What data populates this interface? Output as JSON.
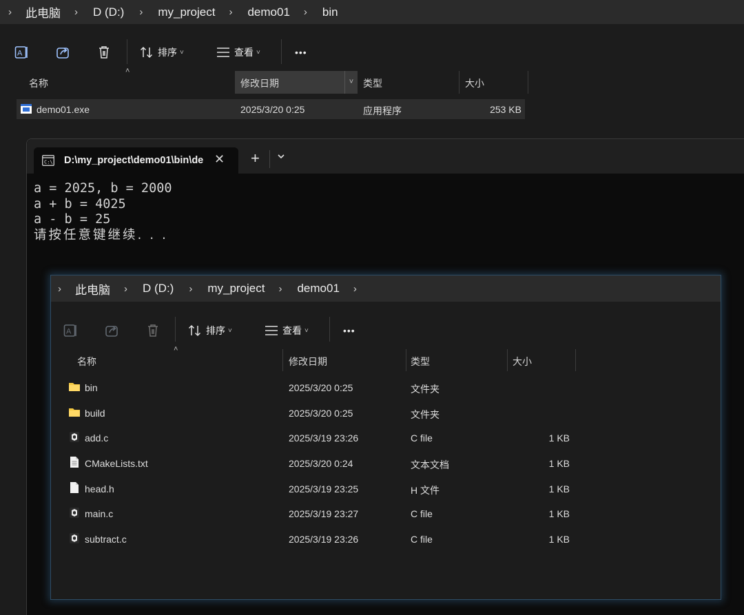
{
  "explorer_back": {
    "breadcrumb": [
      "此电脑",
      "D (D:)",
      "my_project",
      "demo01",
      "bin"
    ],
    "toolbar": {
      "sort_label": "排序",
      "view_label": "查看",
      "more_label": "•••"
    },
    "columns": {
      "name": "名称",
      "date": "修改日期",
      "type": "类型",
      "size": "大小"
    },
    "files": [
      {
        "name": "demo01.exe",
        "date": "2025/3/20 0:25",
        "type": "应用程序",
        "size": "253 KB",
        "icon": "exe-icon"
      }
    ]
  },
  "terminal": {
    "tab_title": "D:\\my_project\\demo01\\bin\\de",
    "new_tab_label": "+",
    "lines": [
      "a = 2025, b = 2000",
      "a + b = 4025",
      "a - b = 25",
      "请按任意键继续. . ."
    ]
  },
  "explorer_front": {
    "breadcrumb": [
      "此电脑",
      "D (D:)",
      "my_project",
      "demo01"
    ],
    "toolbar": {
      "sort_label": "排序",
      "view_label": "查看",
      "more_label": "•••"
    },
    "columns": {
      "name": "名称",
      "date": "修改日期",
      "type": "类型",
      "size": "大小"
    },
    "files": [
      {
        "name": "bin",
        "date": "2025/3/20 0:25",
        "type": "文件夹",
        "size": "",
        "icon": "folder-icon"
      },
      {
        "name": "build",
        "date": "2025/3/20 0:25",
        "type": "文件夹",
        "size": "",
        "icon": "folder-icon"
      },
      {
        "name": "add.c",
        "date": "2025/3/19 23:26",
        "type": "C file",
        "size": "1 KB",
        "icon": "c-file-icon"
      },
      {
        "name": "CMakeLists.txt",
        "date": "2025/3/20 0:24",
        "type": "文本文档",
        "size": "1 KB",
        "icon": "text-file-icon"
      },
      {
        "name": "head.h",
        "date": "2025/3/19 23:25",
        "type": "H 文件",
        "size": "1 KB",
        "icon": "file-icon"
      },
      {
        "name": "main.c",
        "date": "2025/3/19 23:27",
        "type": "C file",
        "size": "1 KB",
        "icon": "c-file-icon"
      },
      {
        "name": "subtract.c",
        "date": "2025/3/19 23:26",
        "type": "C file",
        "size": "1 KB",
        "icon": "c-file-icon"
      }
    ]
  }
}
